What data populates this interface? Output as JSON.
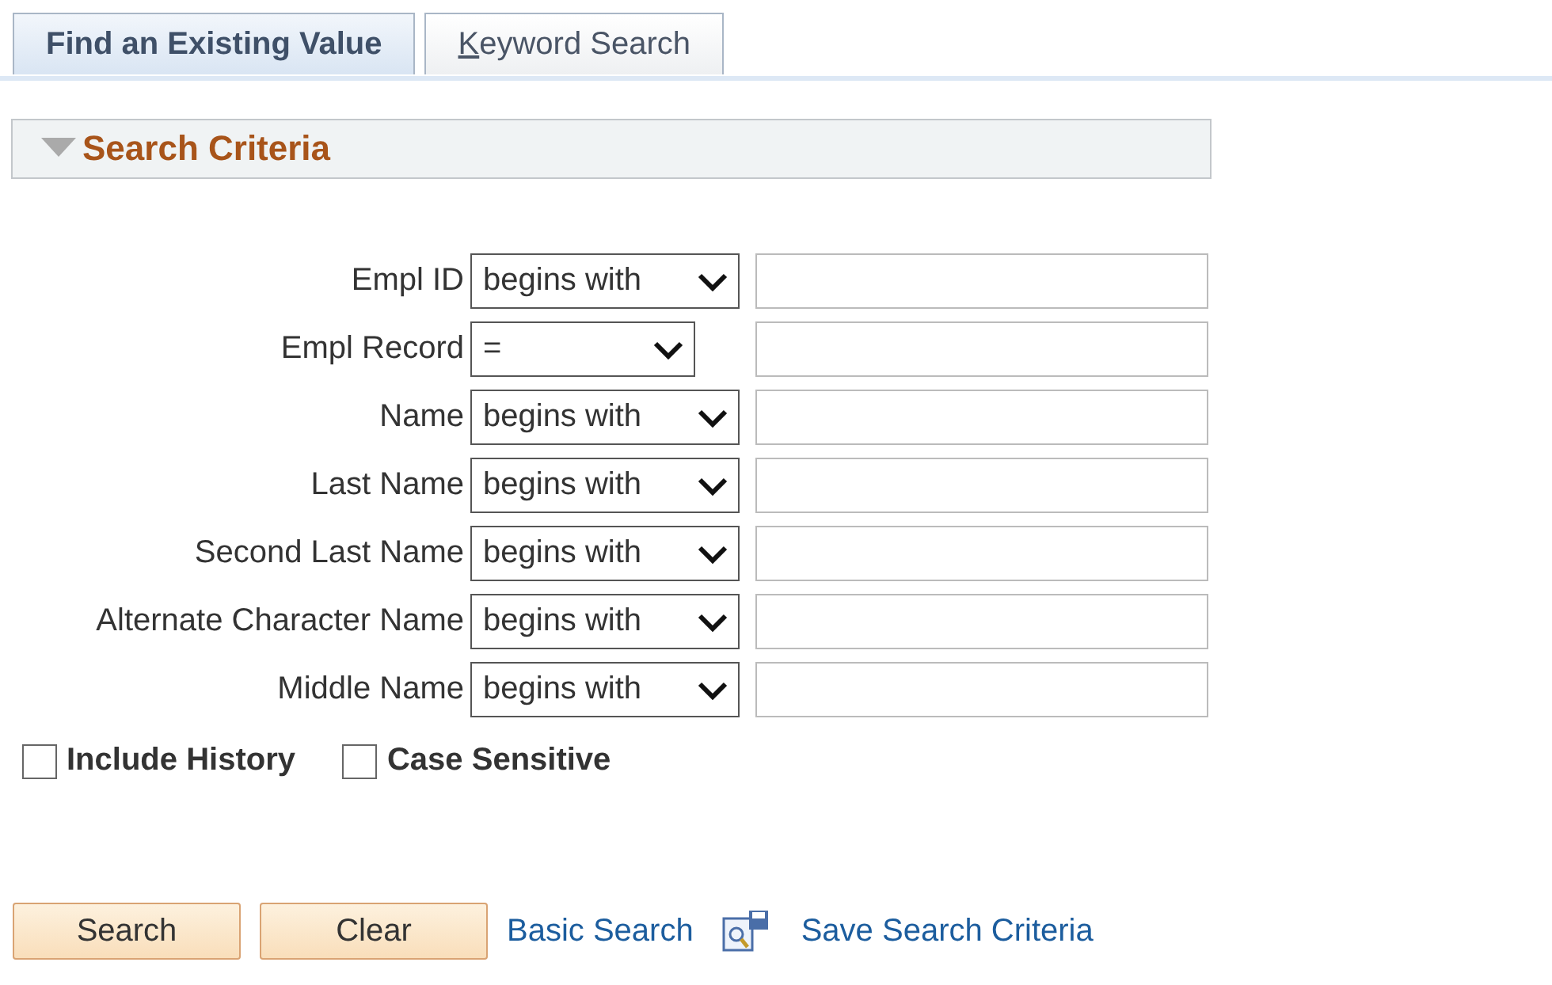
{
  "tabs": [
    {
      "label": "Find an Existing Value",
      "selected": true
    },
    {
      "label": "Keyword Search",
      "selected": false
    }
  ],
  "section": {
    "title": "Search Criteria",
    "expanded": true
  },
  "fields": [
    {
      "label": "Empl ID",
      "operator": "begins with",
      "wide": true
    },
    {
      "label": "Empl Record",
      "operator": "=",
      "wide": false
    },
    {
      "label": "Name",
      "operator": "begins with",
      "wide": true
    },
    {
      "label": "Last Name",
      "operator": "begins with",
      "wide": true
    },
    {
      "label": "Second Last Name",
      "operator": "begins with",
      "wide": true
    },
    {
      "label": "Alternate Character Name",
      "operator": "begins with",
      "wide": true
    },
    {
      "label": "Middle Name",
      "operator": "begins with",
      "wide": true
    }
  ],
  "options": [
    {
      "label": "Include History",
      "checked": false
    },
    {
      "label": "Case Sensitive",
      "checked": false
    }
  ],
  "buttons": [
    "Search",
    "Clear"
  ],
  "links": {
    "basic": "Basic Search",
    "save": "Save Search Criteria"
  }
}
